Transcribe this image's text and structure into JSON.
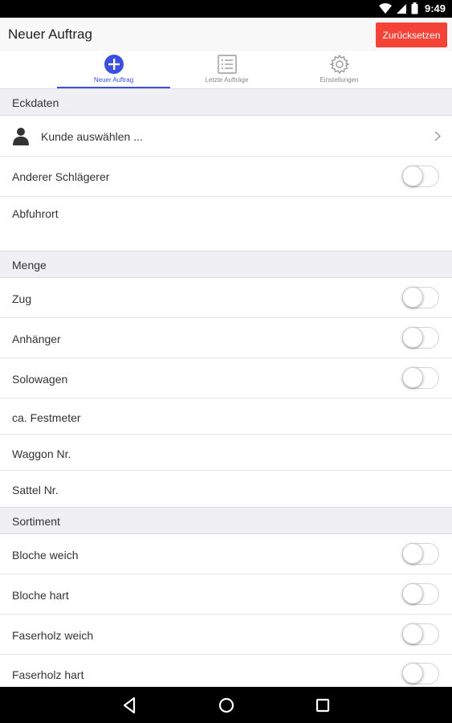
{
  "status_bar": {
    "time": "9:49"
  },
  "app_bar": {
    "title": "Neuer Auftrag",
    "reset_label": "Zurücksetzen"
  },
  "tabs": [
    {
      "label": "Neuer Auftrag",
      "icon": "add-circle-icon",
      "active": true
    },
    {
      "label": "Letzte Aufträge",
      "icon": "list-icon",
      "active": false
    },
    {
      "label": "Einstellungen",
      "icon": "gear-icon",
      "active": false
    }
  ],
  "sections": {
    "eckdaten": {
      "title": "Eckdaten",
      "customer_placeholder": "Kunde auswählen ...",
      "other_striker": "Anderer Schlägerer",
      "pickup_location": "Abfuhrort"
    },
    "menge": {
      "title": "Menge",
      "train": "Zug",
      "trailer": "Anhänger",
      "solo_wagon": "Solowagen",
      "solid_cubic_meters": "ca. Festmeter",
      "wagon_no": "Waggon Nr.",
      "saddle_no": "Sattel Nr."
    },
    "sortiment": {
      "title": "Sortiment",
      "logs_soft": "Bloche weich",
      "logs_hard": "Bloche hart",
      "fiber_soft": "Faserholz weich",
      "fiber_hard": "Faserholz hart"
    }
  },
  "colors": {
    "accent": "#3d4fe0",
    "reset": "#f44336",
    "section_bg": "#efeff4"
  }
}
